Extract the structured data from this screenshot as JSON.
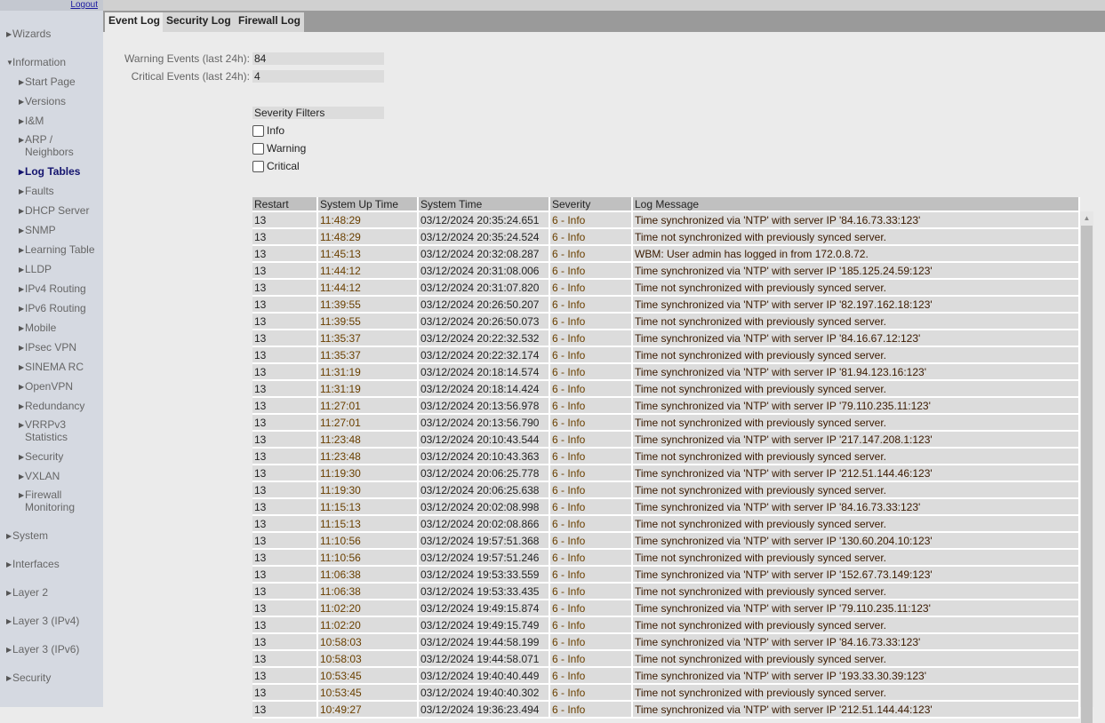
{
  "sidebar": {
    "logout": "Logout",
    "top_items": [
      {
        "label": "Wizards"
      },
      {
        "label": "Information"
      },
      {
        "label": "System"
      },
      {
        "label": "Interfaces"
      },
      {
        "label": "Layer 2"
      },
      {
        "label": "Layer 3 (IPv4)"
      },
      {
        "label": "Layer 3 (IPv6)"
      },
      {
        "label": "Security"
      }
    ],
    "info_items": [
      "Start Page",
      "Versions",
      "I&M",
      "ARP / Neighbors",
      "Log Tables",
      "Faults",
      "DHCP Server",
      "SNMP",
      "Learning Table",
      "LLDP",
      "IPv4 Routing",
      "IPv6 Routing",
      "Mobile",
      "IPsec VPN",
      "SINEMA RC",
      "OpenVPN",
      "Redundancy",
      "VRRPv3 Statistics",
      "Security",
      "VXLAN",
      "Firewall Monitoring"
    ],
    "active": "Log Tables"
  },
  "tabs": [
    "Event Log",
    "Security Log",
    "Firewall Log"
  ],
  "summary": {
    "warning_label": "Warning Events (last 24h):",
    "warning_value": "84",
    "critical_label": "Critical Events (last 24h):",
    "critical_value": "4"
  },
  "filters": {
    "title": "Severity Filters",
    "options": [
      "Info",
      "Warning",
      "Critical"
    ]
  },
  "table": {
    "headers": [
      "Restart",
      "System Up Time",
      "System Time",
      "Severity",
      "Log Message"
    ],
    "rows": [
      [
        "13",
        "11:48:29",
        "03/12/2024 20:35:24.651",
        "6 - Info",
        "Time synchronized via 'NTP' with server IP '84.16.73.33:123'"
      ],
      [
        "13",
        "11:48:29",
        "03/12/2024 20:35:24.524",
        "6 - Info",
        "Time not synchronized with previously synced server."
      ],
      [
        "13",
        "11:45:13",
        "03/12/2024 20:32:08.287",
        "6 - Info",
        "WBM: User admin has logged in from 172.0.8.72."
      ],
      [
        "13",
        "11:44:12",
        "03/12/2024 20:31:08.006",
        "6 - Info",
        "Time synchronized via 'NTP' with server IP '185.125.24.59:123'"
      ],
      [
        "13",
        "11:44:12",
        "03/12/2024 20:31:07.820",
        "6 - Info",
        "Time not synchronized with previously synced server."
      ],
      [
        "13",
        "11:39:55",
        "03/12/2024 20:26:50.207",
        "6 - Info",
        "Time synchronized via 'NTP' with server IP '82.197.162.18:123'"
      ],
      [
        "13",
        "11:39:55",
        "03/12/2024 20:26:50.073",
        "6 - Info",
        "Time not synchronized with previously synced server."
      ],
      [
        "13",
        "11:35:37",
        "03/12/2024 20:22:32.532",
        "6 - Info",
        "Time synchronized via 'NTP' with server IP '84.16.67.12:123'"
      ],
      [
        "13",
        "11:35:37",
        "03/12/2024 20:22:32.174",
        "6 - Info",
        "Time not synchronized with previously synced server."
      ],
      [
        "13",
        "11:31:19",
        "03/12/2024 20:18:14.574",
        "6 - Info",
        "Time synchronized via 'NTP' with server IP '81.94.123.16:123'"
      ],
      [
        "13",
        "11:31:19",
        "03/12/2024 20:18:14.424",
        "6 - Info",
        "Time not synchronized with previously synced server."
      ],
      [
        "13",
        "11:27:01",
        "03/12/2024 20:13:56.978",
        "6 - Info",
        "Time synchronized via 'NTP' with server IP '79.110.235.11:123'"
      ],
      [
        "13",
        "11:27:01",
        "03/12/2024 20:13:56.790",
        "6 - Info",
        "Time not synchronized with previously synced server."
      ],
      [
        "13",
        "11:23:48",
        "03/12/2024 20:10:43.544",
        "6 - Info",
        "Time synchronized via 'NTP' with server IP '217.147.208.1:123'"
      ],
      [
        "13",
        "11:23:48",
        "03/12/2024 20:10:43.363",
        "6 - Info",
        "Time not synchronized with previously synced server."
      ],
      [
        "13",
        "11:19:30",
        "03/12/2024 20:06:25.778",
        "6 - Info",
        "Time synchronized via 'NTP' with server IP '212.51.144.46:123'"
      ],
      [
        "13",
        "11:19:30",
        "03/12/2024 20:06:25.638",
        "6 - Info",
        "Time not synchronized with previously synced server."
      ],
      [
        "13",
        "11:15:13",
        "03/12/2024 20:02:08.998",
        "6 - Info",
        "Time synchronized via 'NTP' with server IP '84.16.73.33:123'"
      ],
      [
        "13",
        "11:15:13",
        "03/12/2024 20:02:08.866",
        "6 - Info",
        "Time not synchronized with previously synced server."
      ],
      [
        "13",
        "11:10:56",
        "03/12/2024 19:57:51.368",
        "6 - Info",
        "Time synchronized via 'NTP' with server IP '130.60.204.10:123'"
      ],
      [
        "13",
        "11:10:56",
        "03/12/2024 19:57:51.246",
        "6 - Info",
        "Time not synchronized with previously synced server."
      ],
      [
        "13",
        "11:06:38",
        "03/12/2024 19:53:33.559",
        "6 - Info",
        "Time synchronized via 'NTP' with server IP '152.67.73.149:123'"
      ],
      [
        "13",
        "11:06:38",
        "03/12/2024 19:53:33.435",
        "6 - Info",
        "Time not synchronized with previously synced server."
      ],
      [
        "13",
        "11:02:20",
        "03/12/2024 19:49:15.874",
        "6 - Info",
        "Time synchronized via 'NTP' with server IP '79.110.235.11:123'"
      ],
      [
        "13",
        "11:02:20",
        "03/12/2024 19:49:15.749",
        "6 - Info",
        "Time not synchronized with previously synced server."
      ],
      [
        "13",
        "10:58:03",
        "03/12/2024 19:44:58.199",
        "6 - Info",
        "Time synchronized via 'NTP' with server IP '84.16.73.33:123'"
      ],
      [
        "13",
        "10:58:03",
        "03/12/2024 19:44:58.071",
        "6 - Info",
        "Time not synchronized with previously synced server."
      ],
      [
        "13",
        "10:53:45",
        "03/12/2024 19:40:40.449",
        "6 - Info",
        "Time synchronized via 'NTP' with server IP '193.33.30.39:123'"
      ],
      [
        "13",
        "10:53:45",
        "03/12/2024 19:40:40.302",
        "6 - Info",
        "Time not synchronized with previously synced server."
      ],
      [
        "13",
        "10:49:27",
        "03/12/2024 19:36:23.494",
        "6 - Info",
        "Time synchronized via 'NTP' with server IP '212.51.144.44:123'"
      ]
    ]
  }
}
